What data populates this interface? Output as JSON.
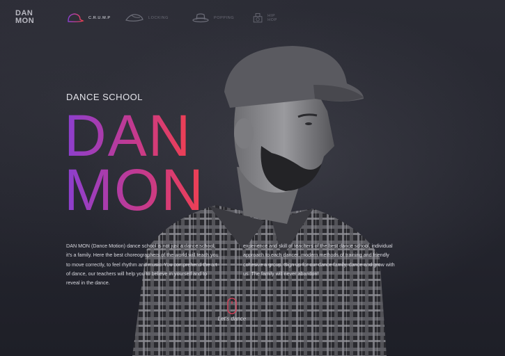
{
  "logo": {
    "line1": "DAN",
    "line2": "MON"
  },
  "nav": [
    {
      "label": "C.R.U.M.P",
      "icon": "cap-icon",
      "active": true
    },
    {
      "label": "LOCKING",
      "icon": "hat-icon",
      "active": false
    },
    {
      "label": "POPPING",
      "icon": "fedora-icon",
      "active": false
    },
    {
      "label": "HIP HOP",
      "icon": "boombox-icon",
      "active": false
    }
  ],
  "hero": {
    "subtitle": "DANCE SCHOOL",
    "title_line1": "DAN",
    "title_line2": "MON",
    "gradient": [
      "#8a3fd0",
      "#c43a8e",
      "#f04050"
    ]
  },
  "about": {
    "col1": "DAN MON (Dance Motion) dance school is not just a dance school, it's a family. Here the best choreographers of the world will teach you to move correctly, to feel rhythm and music. You comprehend the art of dance, our teachers will help you to believe in yourself and to reveal in the dance.",
    "col2": "experience and skill of teachers of the best dance school, individual approach to each dancer, modern methods of training and friendly cohesive a group. Sign up for our dance family, dance and grow with us. The family will never abandon!"
  },
  "cta": {
    "label": "Let's dance",
    "icon": "mouse-icon"
  },
  "colors": {
    "accent": "#e0405a",
    "background": "#262730"
  }
}
